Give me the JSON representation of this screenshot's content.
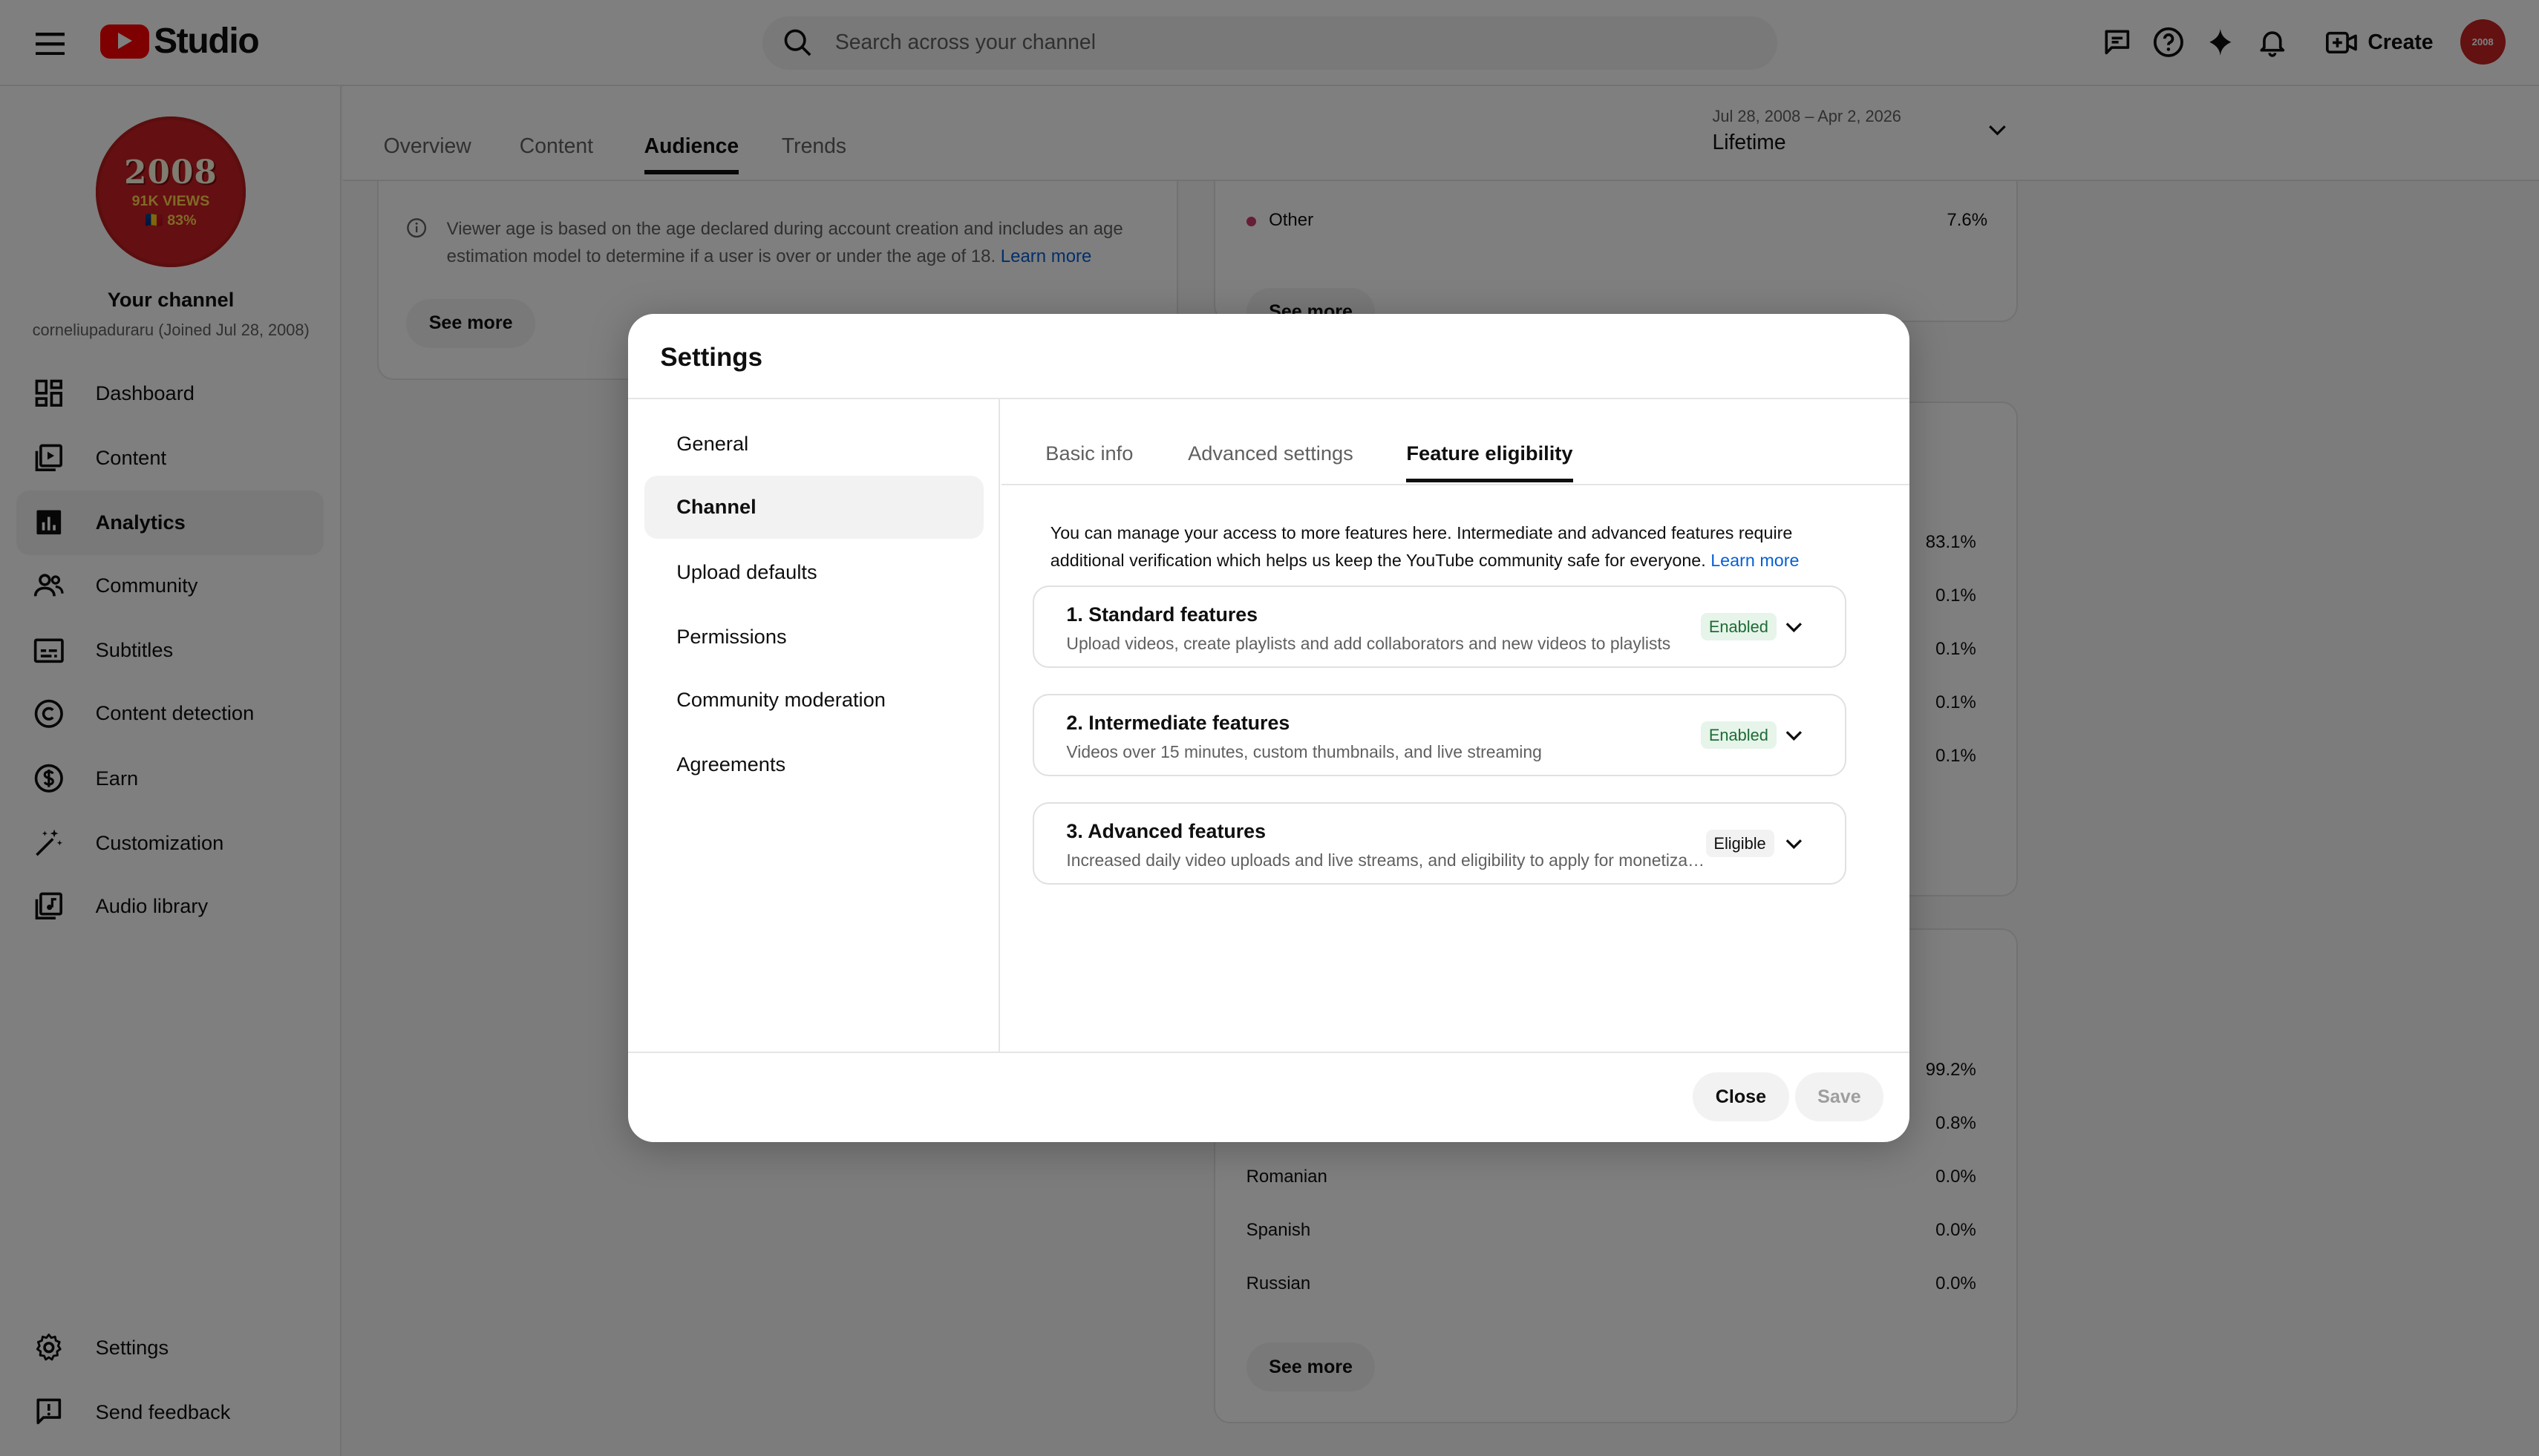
{
  "header": {
    "logo_text": "Studio",
    "search_placeholder": "Search across your channel",
    "create_label": "Create",
    "avatar_text": "2008"
  },
  "sidebar": {
    "channel_avatar": {
      "year": "2008",
      "views": "91K VIEWS",
      "percent": "🇷🇴 83%"
    },
    "channel_name": "Your channel",
    "channel_handle": "corneliupaduraru (Joined Jul 28, 2008)",
    "items": [
      {
        "label": "Dashboard",
        "icon": "dashboard-icon"
      },
      {
        "label": "Content",
        "icon": "content-icon"
      },
      {
        "label": "Analytics",
        "icon": "analytics-icon",
        "active": true
      },
      {
        "label": "Community",
        "icon": "community-icon"
      },
      {
        "label": "Subtitles",
        "icon": "subtitles-icon"
      },
      {
        "label": "Content detection",
        "icon": "copyright-icon"
      },
      {
        "label": "Earn",
        "icon": "dollar-icon"
      },
      {
        "label": "Customization",
        "icon": "magic-wand-icon"
      },
      {
        "label": "Audio library",
        "icon": "audio-library-icon"
      }
    ],
    "bottom_items": [
      {
        "label": "Settings",
        "icon": "gear-icon"
      },
      {
        "label": "Send feedback",
        "icon": "feedback-icon"
      }
    ]
  },
  "main": {
    "tabs": [
      {
        "label": "Overview"
      },
      {
        "label": "Content"
      },
      {
        "label": "Audience",
        "active": true
      },
      {
        "label": "Trends"
      }
    ],
    "date_range": {
      "range": "Jul 28, 2008 – Apr 2, 2026",
      "label": "Lifetime"
    },
    "age_info": "Viewer age is based on the age declared during account creation and includes an age estimation model to determine if a user is over or under the age of 18.",
    "learn_more": "Learn more",
    "see_more": "See more",
    "gender_other": {
      "label": "Other",
      "value": "7.6%"
    },
    "stats_mid": [
      "83.1%",
      "0.1%",
      "0.1%",
      "0.1%",
      "0.1%"
    ],
    "languages": [
      {
        "label": "",
        "value": "99.2%"
      },
      {
        "label": "",
        "value": "0.8%"
      },
      {
        "label": "Romanian",
        "value": "0.0%"
      },
      {
        "label": "Spanish",
        "value": "0.0%"
      },
      {
        "label": "Russian",
        "value": "0.0%"
      }
    ]
  },
  "dialog": {
    "title": "Settings",
    "left_nav": [
      {
        "label": "General"
      },
      {
        "label": "Channel",
        "active": true
      },
      {
        "label": "Upload defaults"
      },
      {
        "label": "Permissions"
      },
      {
        "label": "Community moderation"
      },
      {
        "label": "Agreements"
      }
    ],
    "tabs": [
      {
        "label": "Basic info"
      },
      {
        "label": "Advanced settings"
      },
      {
        "label": "Feature eligibility",
        "active": true
      }
    ],
    "description": "You can manage your access to more features here. Intermediate and advanced features require additional verification which helps us keep the YouTube community safe for everyone.",
    "learn_more": "Learn more",
    "features": [
      {
        "title": "1. Standard features",
        "subtitle": "Upload videos, create playlists and add collaborators and new videos to playlists",
        "status": "Enabled"
      },
      {
        "title": "2. Intermediate features",
        "subtitle": "Videos over 15 minutes, custom thumbnails, and live streaming",
        "status": "Enabled"
      },
      {
        "title": "3. Advanced features",
        "subtitle": "Increased daily video uploads and live streams, and eligibility to apply for monetization",
        "status": "Eligible"
      }
    ],
    "close_label": "Close",
    "save_label": "Save"
  },
  "colors": {
    "accent": "#065fd4",
    "brand_red": "#ff0000",
    "enabled_bg": "#e6f4ea",
    "enabled_text": "#1e6b34"
  }
}
